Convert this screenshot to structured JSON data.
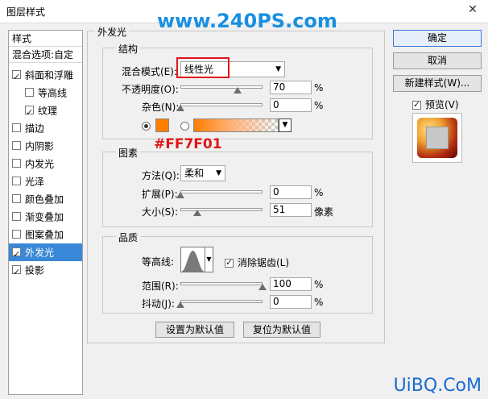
{
  "window": {
    "title": "图层样式"
  },
  "watermark_top": "www.240PS.com",
  "annotation_color_text": "#FF7F01",
  "colors": {
    "accent": "#3a88d8",
    "glow": "#FF7F01",
    "annotation": "#e0161a",
    "watermark": "#1a8fe0"
  },
  "left_panel": {
    "header": "样式",
    "blend_options": "混合选项:自定",
    "items": [
      {
        "label": "斜面和浮雕",
        "checked": true
      },
      {
        "label": "等高线",
        "checked": false
      },
      {
        "label": "纹理",
        "checked": true
      },
      {
        "label": "描边",
        "checked": false
      },
      {
        "label": "内阴影",
        "checked": false
      },
      {
        "label": "内发光",
        "checked": false
      },
      {
        "label": "光泽",
        "checked": false
      },
      {
        "label": "颜色叠加",
        "checked": false
      },
      {
        "label": "渐变叠加",
        "checked": false
      },
      {
        "label": "图案叠加",
        "checked": false
      },
      {
        "label": "外发光",
        "checked": true
      },
      {
        "label": "投影",
        "checked": true
      }
    ]
  },
  "outer_glow": {
    "group_title": "外发光",
    "structure": {
      "title": "结构",
      "blend_mode_label": "混合模式(E):",
      "blend_mode_value": "线性光",
      "opacity_label": "不透明度(O):",
      "opacity_value": "70",
      "opacity_unit": "%",
      "opacity_level": 0.7,
      "noise_label": "杂色(N):",
      "noise_value": "0",
      "noise_unit": "%",
      "noise_level": 0
    },
    "elements": {
      "title": "图素",
      "technique_label": "方法(Q):",
      "technique_value": "柔和",
      "spread_label": "扩展(P):",
      "spread_value": "0",
      "spread_unit": "%",
      "spread_level": 0,
      "size_label": "大小(S):",
      "size_value": "51",
      "size_unit": "像素",
      "size_level": 0.21
    },
    "quality": {
      "title": "品质",
      "contour_label": "等高线:",
      "antialias_label": "消除锯齿(L)",
      "range_label": "范围(R):",
      "range_value": "100",
      "range_unit": "%",
      "range_level": 1.0,
      "jitter_label": "抖动(J):",
      "jitter_value": "0",
      "jitter_unit": "%",
      "jitter_level": 0
    },
    "make_default": "设置为默认值",
    "reset_default": "复位为默认值"
  },
  "right_panel": {
    "ok": "确定",
    "cancel": "取消",
    "new_style": "新建样式(W)...",
    "preview_label": "预览(V)"
  },
  "watermark_bottom": "UiBQ.CoM"
}
